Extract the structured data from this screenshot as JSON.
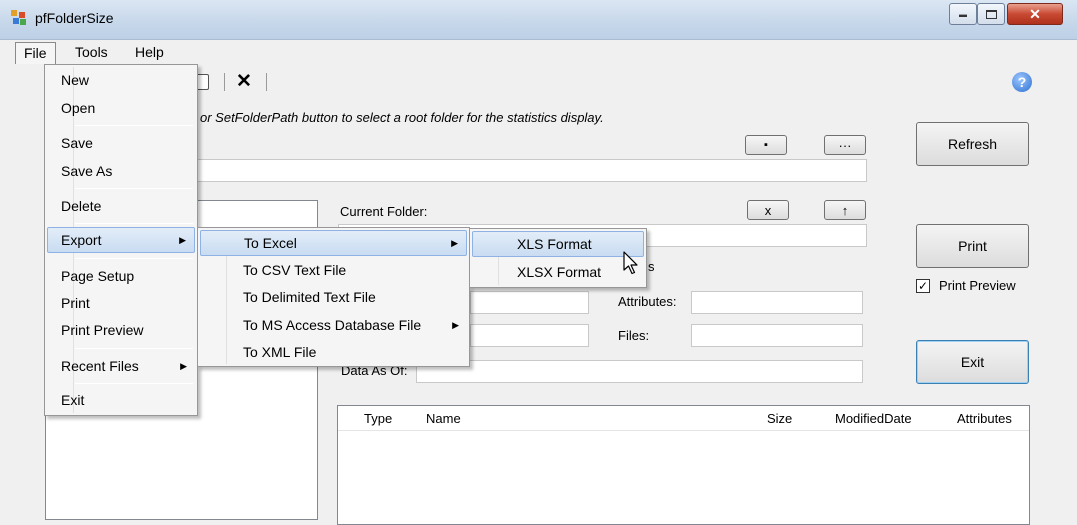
{
  "window": {
    "title": "pfFolderSize",
    "minimize_glyph": "▬",
    "maximize_glyph": "▫",
    "close_glyph": "✕"
  },
  "menubar": {
    "file": "File",
    "tools": "Tools",
    "help": "Help"
  },
  "toolbar": {
    "delete_glyph": "✕",
    "help_glyph": "?"
  },
  "instruction": "or SetFolderPath button to select a root folder for the statistics display.",
  "buttons": {
    "save_path_glyph": "▪",
    "browse": "···",
    "clear": "x",
    "up": "↑",
    "refresh": "Refresh",
    "print": "Print",
    "exit": "Exit"
  },
  "labels": {
    "current_folder": "Current Folder:",
    "attributes": "Attributes:",
    "files": "Files:",
    "data_as_of": "Data As Of:",
    "partial_s": "s",
    "print_preview": "Print Preview"
  },
  "print_preview_checked": true,
  "list_columns": [
    "Type",
    "Name",
    "Size",
    "ModifiedDate",
    "Attributes"
  ],
  "file_menu": {
    "new": "New",
    "open": "Open",
    "save": "Save",
    "save_as": "Save As",
    "delete": "Delete",
    "export": "Export",
    "page_setup": "Page Setup",
    "print": "Print",
    "print_preview": "Print Preview",
    "recent_files": "Recent Files",
    "exit": "Exit"
  },
  "export_menu": {
    "to_excel": "To Excel",
    "to_csv": "To CSV Text File",
    "to_delimited": "To Delimited Text File",
    "to_access": "To MS Access Database File",
    "to_xml": "To XML File"
  },
  "excel_menu": {
    "xls": "XLS Format",
    "xlsx": "XLSX Format"
  },
  "colors": {
    "menu_highlight": "#c9dcf2",
    "titlebar": "#c6d7ea",
    "close_button": "#c84a33"
  }
}
